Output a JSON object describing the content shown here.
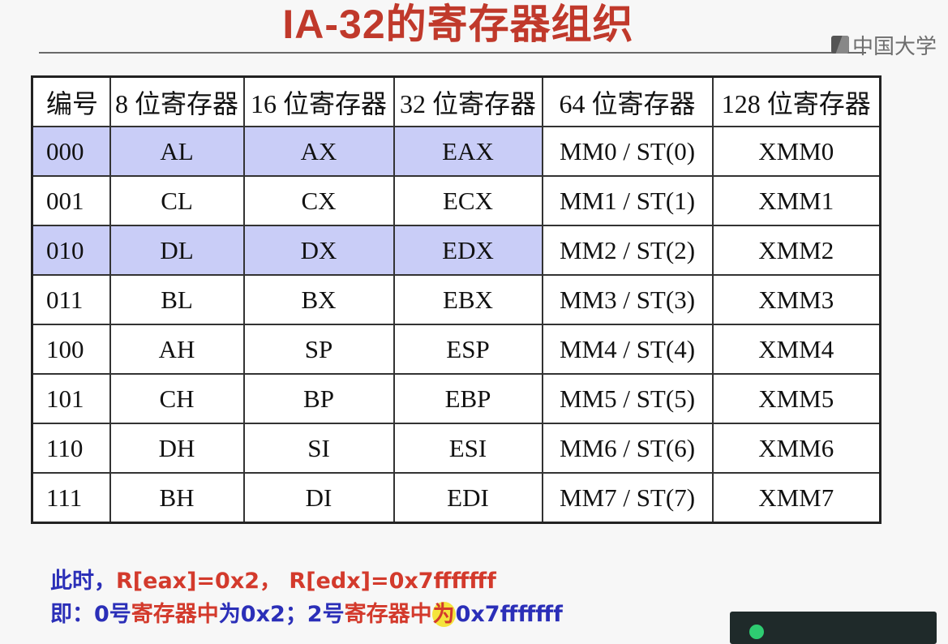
{
  "title": "IA-32的寄存器组织",
  "logo": {
    "text": "中国大学"
  },
  "table": {
    "headers": [
      "编号",
      "8 位寄存器",
      "16 位寄存器",
      "32 位寄存器",
      "64 位寄存器",
      "128 位寄存器"
    ],
    "rows": [
      [
        "000",
        "AL",
        "AX",
        "EAX",
        "MM0 / ST(0)",
        "XMM0"
      ],
      [
        "001",
        "CL",
        "CX",
        "ECX",
        "MM1 / ST(1)",
        "XMM1"
      ],
      [
        "010",
        "DL",
        "DX",
        "EDX",
        "MM2 / ST(2)",
        "XMM2"
      ],
      [
        "011",
        "BL",
        "BX",
        "EBX",
        "MM3 / ST(3)",
        "XMM3"
      ],
      [
        "100",
        "AH",
        "SP",
        "ESP",
        "MM4 / ST(4)",
        "XMM4"
      ],
      [
        "101",
        "CH",
        "BP",
        "EBP",
        "MM5 / ST(5)",
        "XMM5"
      ],
      [
        "110",
        "DH",
        "SI",
        "ESI",
        "MM6 / ST(6)",
        "XMM6"
      ],
      [
        "111",
        "BH",
        "DI",
        "EDI",
        "MM7 / ST(7)",
        "XMM7"
      ]
    ],
    "highlight_color": "#c9cdf7"
  },
  "notes": {
    "line1": {
      "prefix": "此时，",
      "body": "R[eax]=0x2， R[edx]=0x7fffffff"
    },
    "line2": {
      "p1": "即：0号",
      "p2": "寄存器中",
      "p3": "为0x2；2号",
      "p4": "寄存器中",
      "p5": "为",
      "p6": "0x7fffffff"
    },
    "colors": {
      "blue": "#2b2fb8",
      "red": "#d33a2c",
      "highlight": "#f4e43c"
    }
  }
}
